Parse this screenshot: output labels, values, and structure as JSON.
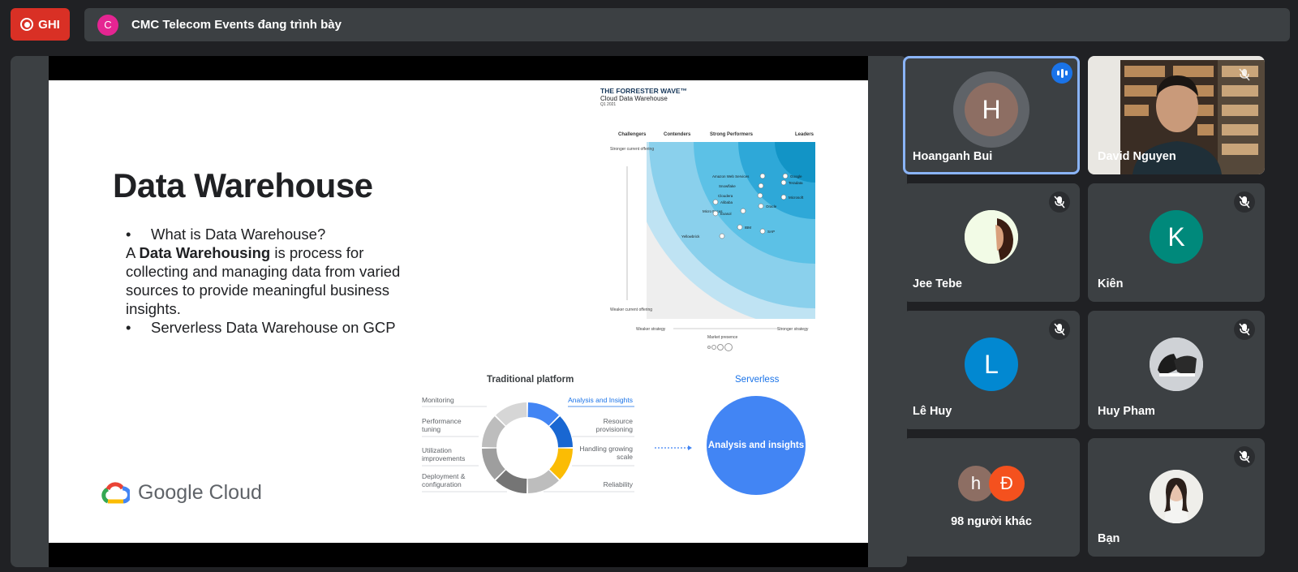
{
  "topbar": {
    "record_label": "GHI",
    "presenter_initial": "C",
    "presenter_text": "CMC Telecom Events đang trình bày"
  },
  "slide": {
    "title": "Data Warehouse",
    "bullet1": "What is Data Warehouse?",
    "para_prefix": "A ",
    "para_bold": "Data Warehousing",
    "para_rest": " is process for collecting and managing data from varied sources to provide meaningful business insights.",
    "bullet2": "Serverless Data Warehouse on GCP",
    "brand": "Google Cloud",
    "forrester": {
      "title": "THE FORRESTER WAVE™",
      "subtitle": "Cloud Data Warehouse",
      "period": "Q1 2021",
      "columns": [
        "Challengers",
        "Contenders",
        "Strong Performers",
        "Leaders"
      ],
      "y_top": "Stronger current offering",
      "y_bottom": "Weaker current offering",
      "x_left": "Weaker strategy",
      "x_right": "Stronger strategy",
      "market": "Market presence",
      "vendors": [
        "Amazon Web Services",
        "Google",
        "Snowflake",
        "Teradata",
        "Cloudera",
        "Microsoft",
        "Alibaba",
        "Oracle",
        "Micro Focus",
        "Exasol",
        "IBM",
        "SAP",
        "Yellowbrick"
      ]
    },
    "traditional": {
      "title": "Traditional platform",
      "left_labels": [
        "Monitoring",
        "Performance tuning",
        "Utilization improvements",
        "Deployment & configuration"
      ],
      "right_labels": [
        "Analysis and Insights",
        "Resource provisioning",
        "Handling growing scale",
        "Reliability"
      ],
      "serverless_title": "Serverless",
      "serverless_circle": "Analysis and insights"
    }
  },
  "participants": [
    {
      "name": "Hoanganh Bui",
      "initial": "H",
      "color": "#8d6e63",
      "state": "speaking"
    },
    {
      "name": "David Nguyen",
      "state": "video-muted"
    },
    {
      "name": "Jee Tebe",
      "state": "muted"
    },
    {
      "name": "Kiên",
      "initial": "K",
      "color": "#00897b",
      "state": "muted"
    },
    {
      "name": "Lê Huy",
      "initial": "L",
      "color": "#0288d1",
      "state": "muted"
    },
    {
      "name": "Huy Pham",
      "state": "muted"
    },
    {
      "name": "98 người khác",
      "initials": [
        "h",
        "Đ"
      ],
      "colors": [
        "#8d6e63",
        "#f4511e"
      ]
    },
    {
      "name": "Bạn",
      "state": "muted"
    }
  ]
}
